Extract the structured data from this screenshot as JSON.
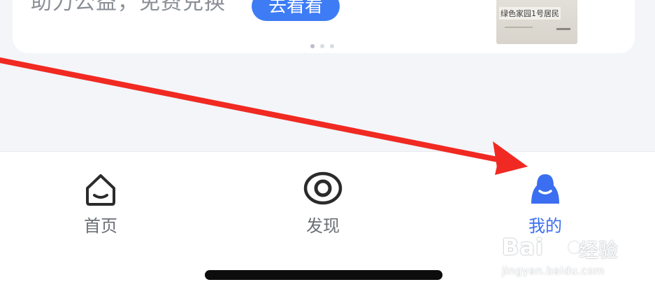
{
  "banner": {
    "text": "助力公益，免费兑换",
    "button_label": "去看看",
    "image_label": "绿色家园1号居民",
    "carousel": {
      "count": 3,
      "active_index": 0
    }
  },
  "tabbar": {
    "tabs": [
      {
        "id": "home",
        "label": "首页",
        "icon": "home-icon",
        "selected": false
      },
      {
        "id": "discover",
        "label": "发现",
        "icon": "eye-icon",
        "selected": false
      },
      {
        "id": "mine",
        "label": "我的",
        "icon": "user-icon",
        "selected": true
      }
    ]
  },
  "annotation": {
    "arrow_color": "#f02a22"
  },
  "watermark": {
    "brand": "Bai",
    "brand_suffix": "经验",
    "url": "jingyan.baidu.com"
  },
  "colors": {
    "accent": "#3b6ef0",
    "inactive": "#6b6f76",
    "background": "#f3f5f9"
  }
}
